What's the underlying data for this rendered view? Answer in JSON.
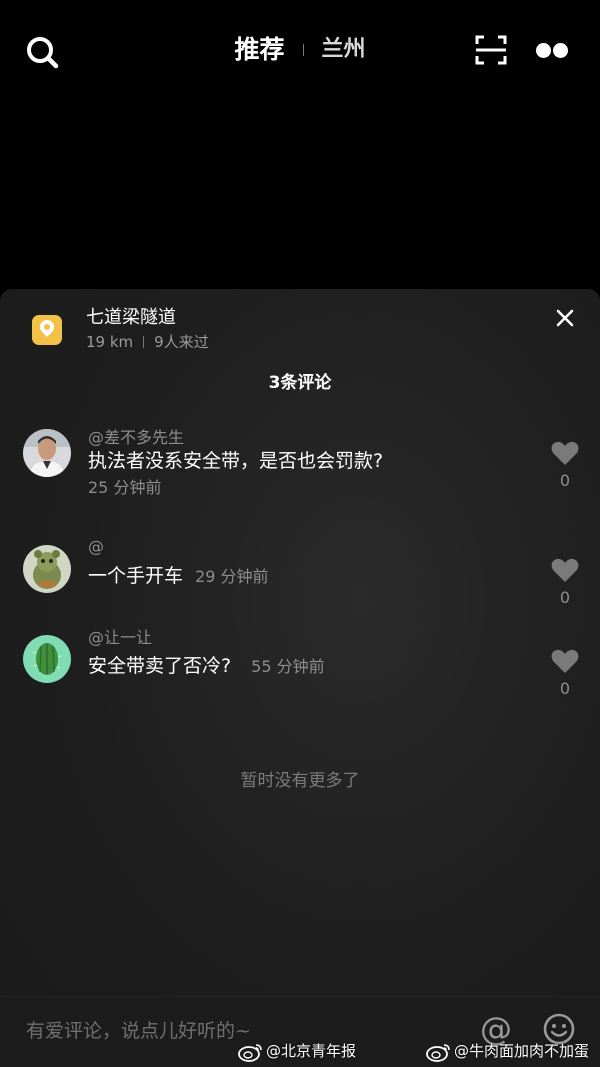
{
  "header": {
    "tabs": [
      {
        "label": "推荐",
        "active": true
      },
      {
        "label": "兰州",
        "active": false
      }
    ],
    "icons": [
      "search-icon",
      "scan-icon",
      "more-dots-icon"
    ]
  },
  "location": {
    "name": "七道梁隧道",
    "distance": "19 km",
    "visitors": "9人来过",
    "icon": "location-pin-icon",
    "icon_color": "#f2c248"
  },
  "comments_header": {
    "count_label": "3条评论"
  },
  "comments": [
    {
      "user": "@差不多先生",
      "text": "执法者没系安全带，是否也会罚款?",
      "time": "25 分钟前",
      "likes": "0"
    },
    {
      "user": "@",
      "text": "一个手开车",
      "time": "29 分钟前",
      "likes": "0"
    },
    {
      "user": "@让一让",
      "text": "安全带卖了否冷?",
      "time": "55 分钟前",
      "likes": "0"
    }
  ],
  "footer_note": "暂时没有更多了",
  "input": {
    "placeholder": "有爱评论，说点儿好听的~",
    "value": "",
    "at_symbol": "@"
  },
  "watermarks": [
    {
      "text": "@北京青年报"
    },
    {
      "text": "@牛肉面加肉不加蛋"
    }
  ],
  "colors": {
    "background": "#000000",
    "panel": "#1e1e1e",
    "accent": "#f2c248",
    "muted_text": "#8e8e8e"
  }
}
